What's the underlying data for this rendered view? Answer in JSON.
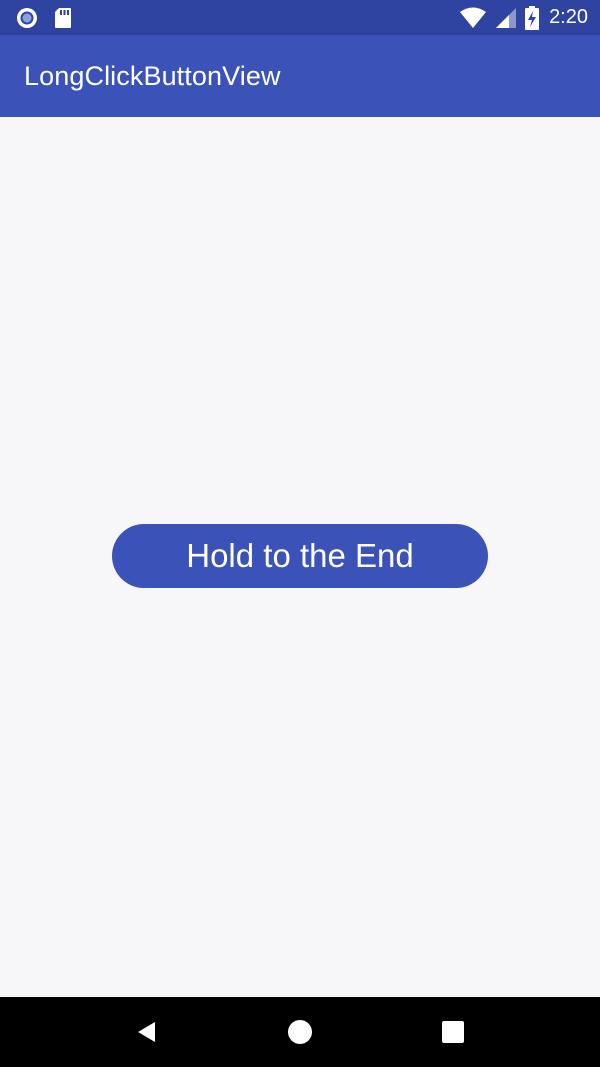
{
  "status_bar": {
    "time": "2:20",
    "left_icons": [
      "circle-notification-icon",
      "sd-card-icon"
    ],
    "right_icons": [
      "wifi-icon",
      "cell-signal-icon",
      "battery-charging-icon"
    ]
  },
  "app_bar": {
    "title": "LongClickButtonView"
  },
  "main": {
    "hold_button_label": "Hold to the End"
  },
  "nav_bar": {
    "buttons": [
      "back-icon",
      "home-icon",
      "recents-icon"
    ]
  },
  "colors": {
    "status_bar": "#2f43a0",
    "primary": "#3b52b9",
    "background": "#f7f6f8",
    "nav_bar": "#000000"
  }
}
